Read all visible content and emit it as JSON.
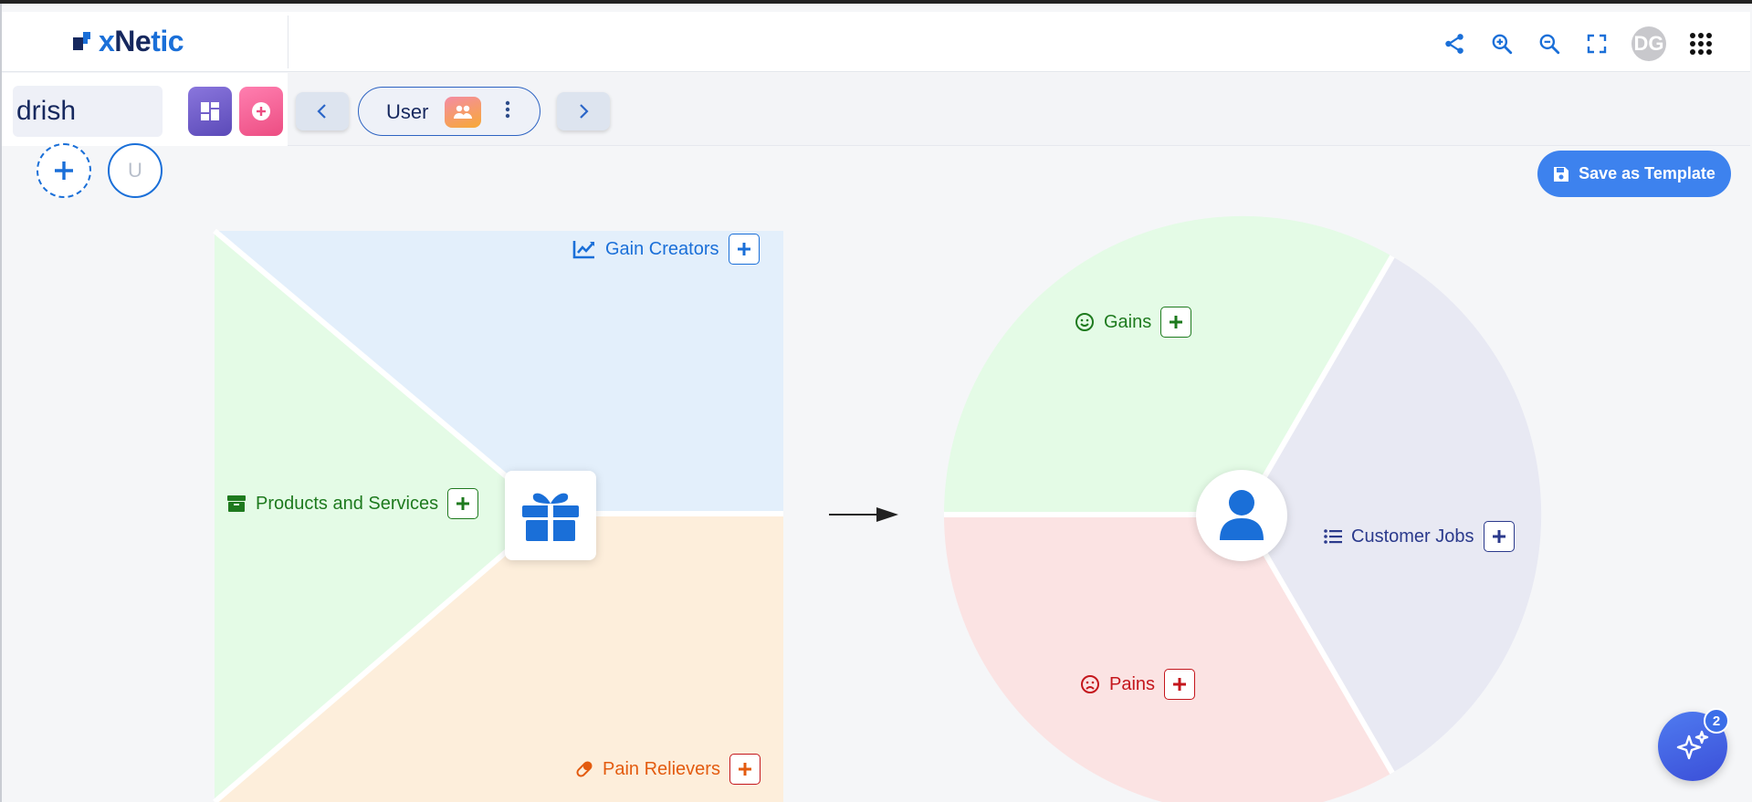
{
  "app": {
    "logo_text_x": "x",
    "logo_text_ne": "Ne",
    "logo_text_tic": "tic",
    "brand_color": "#1a6fd8"
  },
  "header": {
    "icons": [
      "share-icon",
      "zoom-in-icon",
      "zoom-out-icon",
      "fullscreen-icon"
    ],
    "avatar_initials": "DG",
    "apps_icon": "grid-apps-icon"
  },
  "toolbar": {
    "name_value": "drish",
    "persona_label": "User",
    "prev_icon": "chevron-left-icon",
    "next_icon": "chevron-right-icon"
  },
  "personas": {
    "add_icon": "plus-icon",
    "initial": "U"
  },
  "actions": {
    "save_template": "Save as Template"
  },
  "value_map": {
    "gain_creators": "Gain Creators",
    "products_services": "Products and Services",
    "pain_relievers": "Pain Relievers"
  },
  "customer_profile": {
    "gains": "Gains",
    "customer_jobs": "Customer Jobs",
    "pains": "Pains"
  },
  "assistant": {
    "badge_count": "2"
  },
  "colors": {
    "gain_creators_bg": "#e3effb",
    "products_bg": "#e4fbe6",
    "pain_relievers_bg": "#fdeedb",
    "gains_bg": "#e4fbe6",
    "jobs_bg": "#e8e9f3",
    "pains_bg": "#fbe3e3",
    "green": "#1e7a1e",
    "blue": "#1a6fd8",
    "orange": "#e35b0f",
    "red": "#c4161c",
    "navy": "#2b3a8c"
  }
}
